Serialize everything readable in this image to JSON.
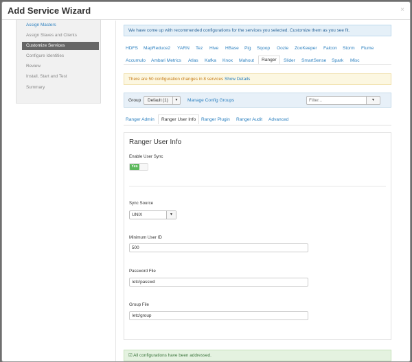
{
  "window": {
    "title": "Add Service Wizard",
    "close_glyph": "×"
  },
  "sidebar": {
    "items": [
      {
        "label": "Assign Masters",
        "state": "link"
      },
      {
        "label": "Assign Slaves and Clients",
        "state": "done"
      },
      {
        "label": "Customize Services",
        "state": "active"
      },
      {
        "label": "Configure Identities",
        "state": "pending"
      },
      {
        "label": "Review",
        "state": "pending"
      },
      {
        "label": "Install, Start and Test",
        "state": "pending"
      },
      {
        "label": "Summary",
        "state": "pending"
      }
    ]
  },
  "banners": {
    "info": "We have come up with recommended configurations for the services you selected. Customize them as you see fit.",
    "warning_text": "There are 50 configuration changes in 8 services",
    "warning_link": "Show Details",
    "success": "All configurations have been addressed."
  },
  "service_tabs": {
    "row1": [
      "HDFS",
      "MapReduce2",
      "YARN",
      "Tez",
      "Hive",
      "HBase",
      "Pig",
      "Sqoop",
      "Oozie",
      "ZooKeeper",
      "Falcon",
      "Storm",
      "Flume"
    ],
    "row2": [
      "Accumulo",
      "Ambari Metrics",
      "Atlas",
      "Kafka",
      "Knox",
      "Mahout",
      "Ranger",
      "Slider",
      "SmartSense",
      "Spark",
      "Misc"
    ],
    "active": "Ranger"
  },
  "group_bar": {
    "label": "Group",
    "selected": "Default (1)",
    "manage_link": "Manage Config Groups",
    "filter_placeholder": "Filter..."
  },
  "sub_tabs": {
    "items": [
      "Ranger Admin",
      "Ranger User Info",
      "Ranger Plugin",
      "Ranger Audit",
      "Advanced"
    ],
    "active": "Ranger User Info"
  },
  "panel": {
    "title": "Ranger User Info",
    "enable_sync_label": "Enable User Sync",
    "toggle_on_label": "Yes",
    "sync_source_label": "Sync Source",
    "sync_source_value": "UNIX",
    "min_uid_label": "Minimum User ID",
    "min_uid_value": "500",
    "password_file_label": "Password File",
    "password_file_value": "/etc/passwd",
    "group_file_label": "Group File",
    "group_file_value": "/etc/group"
  },
  "colors": {
    "link": "#2a7fbf",
    "active_sidebar": "#666666",
    "toggle_on": "#5cb85c"
  }
}
